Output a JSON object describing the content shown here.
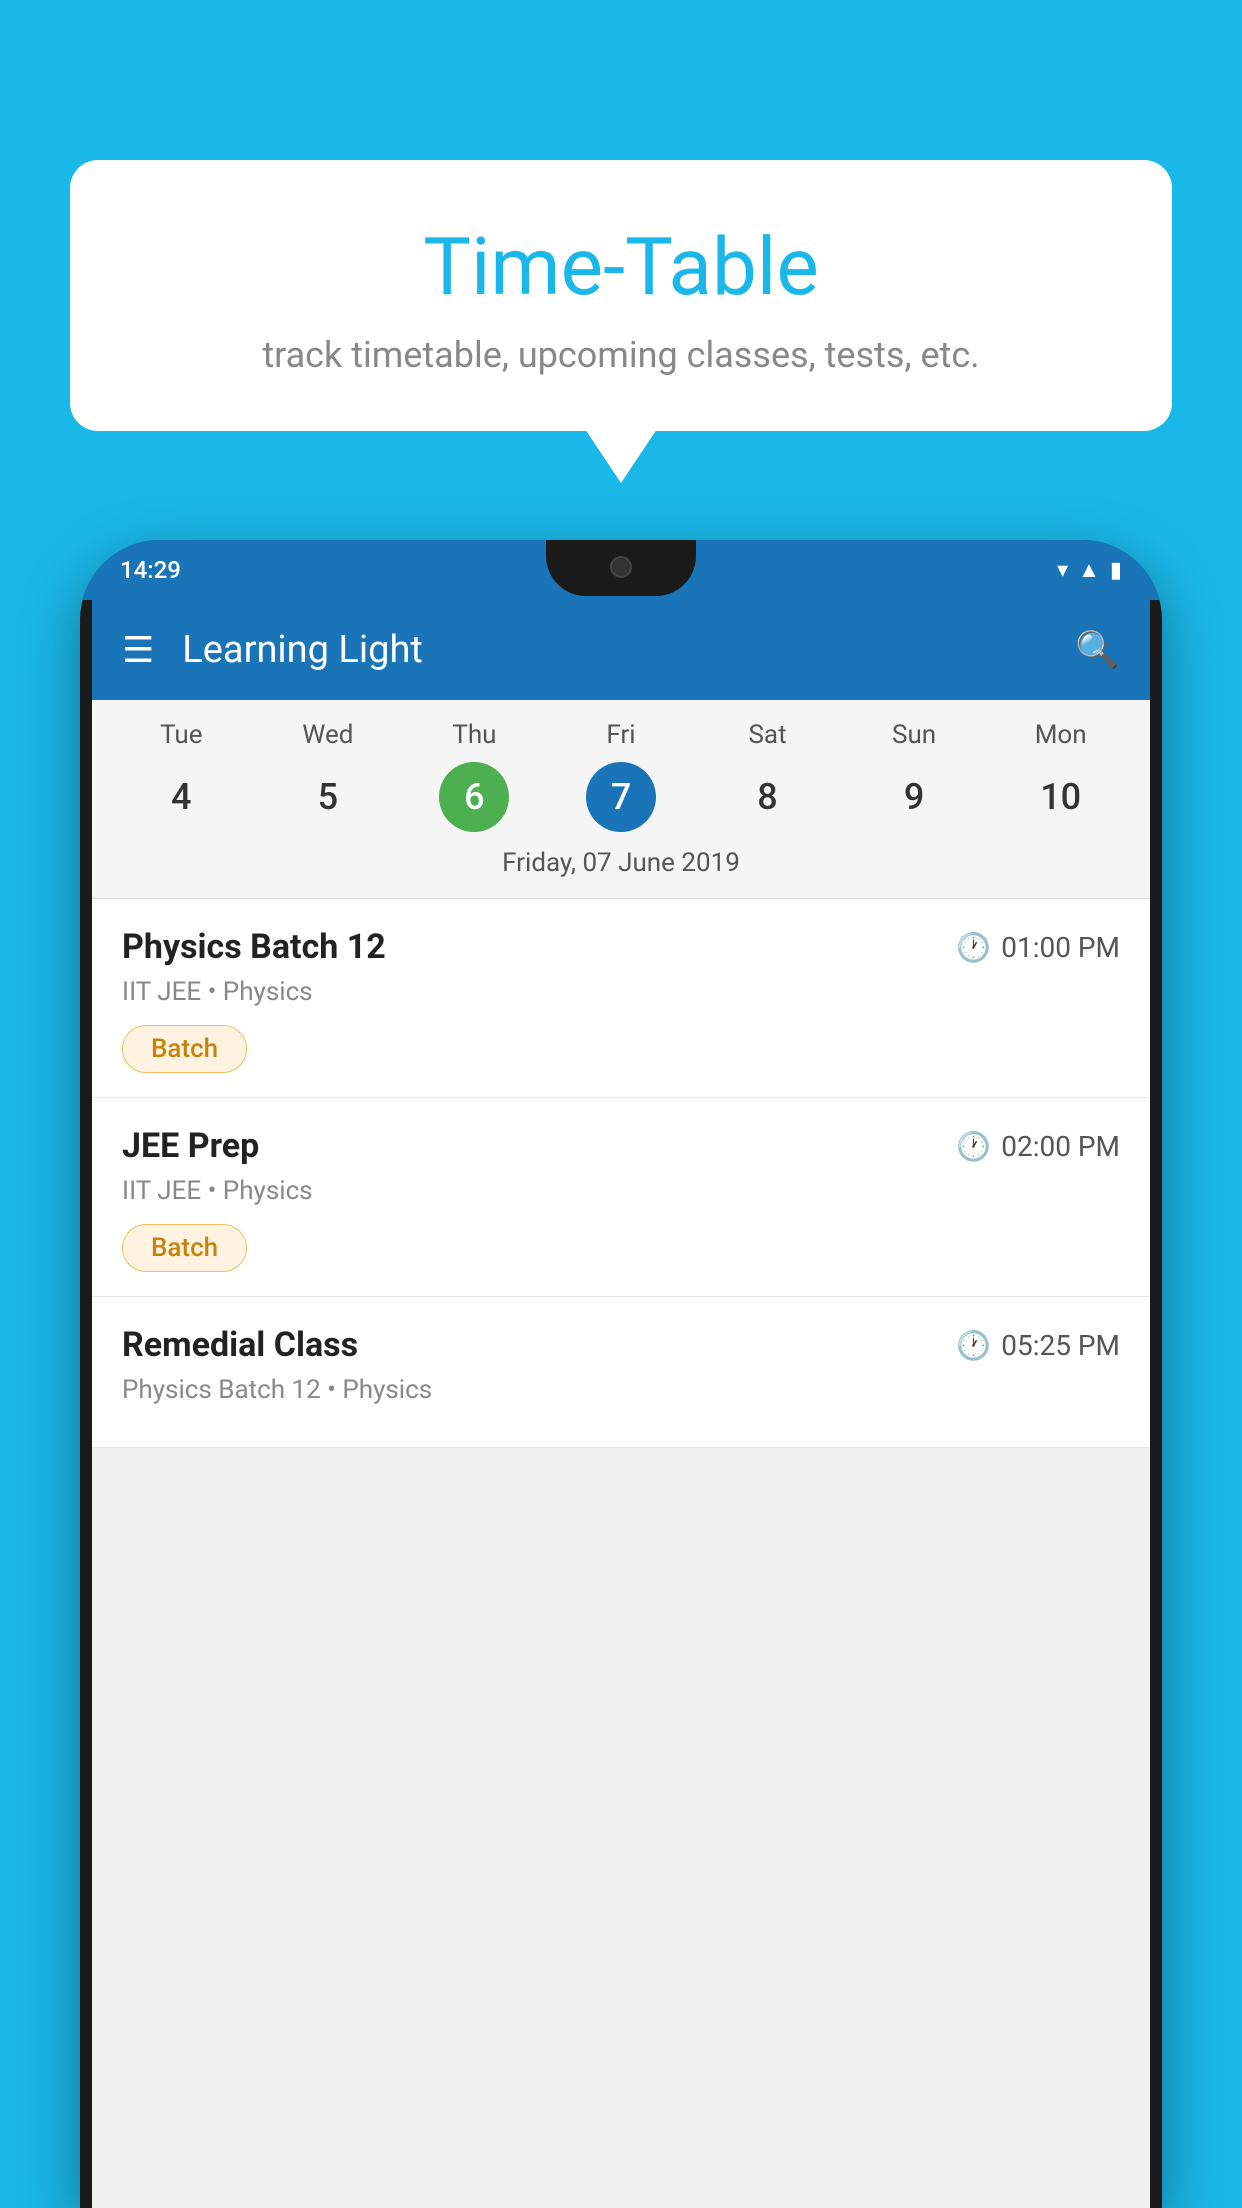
{
  "background_color": "#1ab8e8",
  "speech_bubble": {
    "title": "Time-Table",
    "subtitle": "track timetable, upcoming classes, tests, etc."
  },
  "phone": {
    "status_bar": {
      "time": "14:29"
    },
    "app_bar": {
      "title": "Learning Light",
      "menu_icon": "hamburger",
      "search_icon": "search"
    },
    "calendar": {
      "days": [
        {
          "label": "Tue",
          "num": "4",
          "state": "normal"
        },
        {
          "label": "Wed",
          "num": "5",
          "state": "normal"
        },
        {
          "label": "Thu",
          "num": "6",
          "state": "today"
        },
        {
          "label": "Fri",
          "num": "7",
          "state": "selected"
        },
        {
          "label": "Sat",
          "num": "8",
          "state": "normal"
        },
        {
          "label": "Sun",
          "num": "9",
          "state": "normal"
        },
        {
          "label": "Mon",
          "num": "10",
          "state": "normal"
        }
      ],
      "selected_date_label": "Friday, 07 June 2019"
    },
    "schedule": [
      {
        "title": "Physics Batch 12",
        "time": "01:00 PM",
        "subtitle": "IIT JEE • Physics",
        "tag": "Batch"
      },
      {
        "title": "JEE Prep",
        "time": "02:00 PM",
        "subtitle": "IIT JEE • Physics",
        "tag": "Batch"
      },
      {
        "title": "Remedial Class",
        "time": "05:25 PM",
        "subtitle": "Physics Batch 12 • Physics",
        "tag": ""
      }
    ]
  }
}
